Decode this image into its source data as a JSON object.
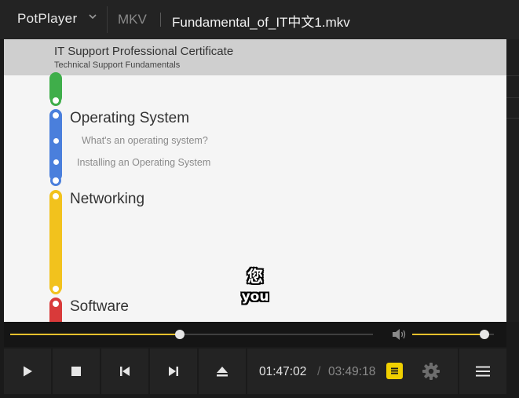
{
  "titlebar": {
    "app_name": "PotPlayer",
    "format": "MKV",
    "filename": "Fundamental_of_IT中文1.mkv"
  },
  "slide": {
    "title": "IT Support Professional Certificate",
    "subtitle": "Technical Support Fundamentals",
    "sections": [
      {
        "label": "Operating System",
        "color": "#4a7fdc",
        "items": [
          "What's an operating system?",
          "Installing an Operating System"
        ]
      },
      {
        "label": "Networking",
        "color": "#f2c21d",
        "items": []
      },
      {
        "label": "Software",
        "color": "#d93a3a",
        "items": []
      }
    ],
    "top_track_color": "#3fae4a"
  },
  "subtitles": {
    "zh": "您",
    "en": "you"
  },
  "playback": {
    "current_time": "01:47:02",
    "separator": "/",
    "total_time": "03:49:18",
    "progress_fraction": 0.467,
    "volume_fraction": 0.88,
    "accent_color": "#e8c12c"
  },
  "icons": {
    "app_menu": "chevron-down-icon",
    "play": "play-icon",
    "stop": "stop-icon",
    "prev": "previous-icon",
    "next": "next-icon",
    "eject": "eject-icon",
    "subtitle": "subtitle-icon",
    "settings": "gear-icon",
    "menu": "menu-icon",
    "volume": "volume-icon"
  }
}
